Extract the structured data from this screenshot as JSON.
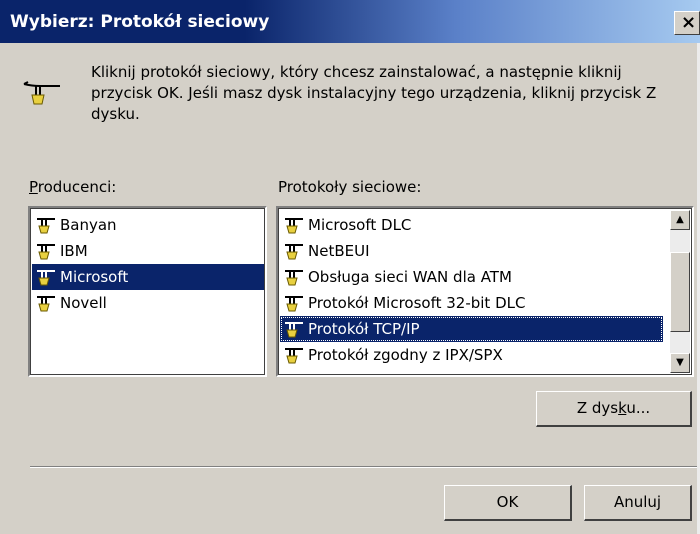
{
  "window": {
    "title": "Wybierz: Protokół sieciowy",
    "close_glyph": "×"
  },
  "instructions": {
    "text": "Kliknij protokół sieciowy, który chcesz zainstalować, a następnie kliknij przycisk OK. Jeśli masz dysk instalacyjny tego urządzenia, kliknij przycisk Z dysku.",
    "icon": "network-protocol-icon"
  },
  "manufacturers": {
    "label_mnemonic": "P",
    "label_rest": "roducenci:",
    "items": [
      {
        "label": "Banyan",
        "selected": false
      },
      {
        "label": "IBM",
        "selected": false
      },
      {
        "label": "Microsoft",
        "selected": true
      },
      {
        "label": "Novell",
        "selected": false
      }
    ]
  },
  "protocols": {
    "label": "Protokoły sieciowe:",
    "items": [
      {
        "label": "Microsoft DLC",
        "selected": false
      },
      {
        "label": "NetBEUI",
        "selected": false
      },
      {
        "label": "Obsługa sieci WAN dla ATM",
        "selected": false
      },
      {
        "label": "Protokół Microsoft 32-bit DLC",
        "selected": false
      },
      {
        "label": "Protokół TCP/IP",
        "selected": true
      },
      {
        "label": "Protokół zgodny z IPX/SPX",
        "selected": false
      }
    ]
  },
  "buttons": {
    "have_disk_pre": "Z dys",
    "have_disk_mnemonic": "k",
    "have_disk_post": "u...",
    "ok": "OK",
    "cancel": "Anuluj"
  },
  "colors": {
    "selection": "#0a246a",
    "face": "#d4d0c8",
    "title_start": "#0a246a",
    "title_end": "#a6caf0"
  }
}
